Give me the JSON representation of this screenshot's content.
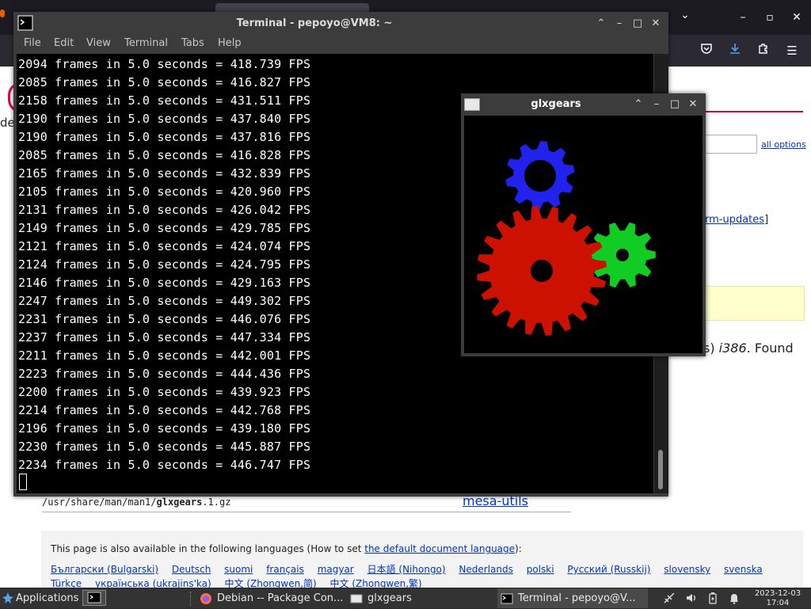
{
  "terminal": {
    "title": "Terminal - pepoyo@VM8: ~",
    "menu": [
      "File",
      "Edit",
      "View",
      "Terminal",
      "Tabs",
      "Help"
    ],
    "lines": [
      "2094 frames in 5.0 seconds = 418.739 FPS",
      "2085 frames in 5.0 seconds = 416.827 FPS",
      "2158 frames in 5.0 seconds = 431.511 FPS",
      "2190 frames in 5.0 seconds = 437.840 FPS",
      "2190 frames in 5.0 seconds = 437.816 FPS",
      "2085 frames in 5.0 seconds = 416.828 FPS",
      "2165 frames in 5.0 seconds = 432.839 FPS",
      "2105 frames in 5.0 seconds = 420.960 FPS",
      "2131 frames in 5.0 seconds = 426.042 FPS",
      "2149 frames in 5.0 seconds = 429.785 FPS",
      "2121 frames in 5.0 seconds = 424.074 FPS",
      "2124 frames in 5.0 seconds = 424.795 FPS",
      "2146 frames in 5.0 seconds = 429.163 FPS",
      "2247 frames in 5.0 seconds = 449.302 FPS",
      "2231 frames in 5.0 seconds = 446.076 FPS",
      "2237 frames in 5.0 seconds = 447.334 FPS",
      "2211 frames in 5.0 seconds = 442.001 FPS",
      "2223 frames in 5.0 seconds = 444.436 FPS",
      "2200 frames in 5.0 seconds = 439.923 FPS",
      "2214 frames in 5.0 seconds = 442.768 FPS",
      "2196 frames in 5.0 seconds = 439.180 FPS",
      "2230 frames in 5.0 seconds = 445.887 FPS",
      "2234 frames in 5.0 seconds = 446.747 FPS"
    ]
  },
  "glxgears": {
    "title": "glxgears",
    "gear_colors": {
      "red": "#cc1100",
      "green": "#11cc22",
      "blue": "#2222ee"
    }
  },
  "browser": {
    "logo_fragment": "de",
    "all_options": "all options",
    "updates_link": "rm-updates",
    "updates_bracket": "]",
    "found_prefix": "s)",
    "found_arch": "i386",
    "found_suffix": ". Found",
    "manpath_prefix": "/usr/share/man/man1/",
    "manpath_bold": "glxgears",
    "manpath_suffix": ".1.gz",
    "package_link": "mesa-utils",
    "lang_intro_prefix": "This page is also available in the following languages (How to set ",
    "lang_intro_link": "the default document language",
    "lang_intro_suffix": "):",
    "languages": [
      "Български (Bulgarski)",
      "Deutsch",
      "suomi",
      "français",
      "magyar",
      "日本語 (Nihongo)",
      "Nederlands",
      "polski",
      "Русский (Russkij)",
      "slovensky",
      "svenska",
      "Türkçe",
      "українська (ukrajins'ka)",
      "中文 (Zhongwen,简)",
      "中文 (Zhongwen,繁)"
    ]
  },
  "taskbar": {
    "applications": "Applications",
    "tasks": [
      {
        "label": "Debian -- Package Con...",
        "icon": "firefox-icon"
      },
      {
        "label": "glxgears",
        "icon": "window-icon"
      },
      {
        "label": "Terminal - pepoyo@V...",
        "icon": "terminal-icon"
      }
    ],
    "clock_date": "2023-12-03",
    "clock_time": "17:04"
  }
}
